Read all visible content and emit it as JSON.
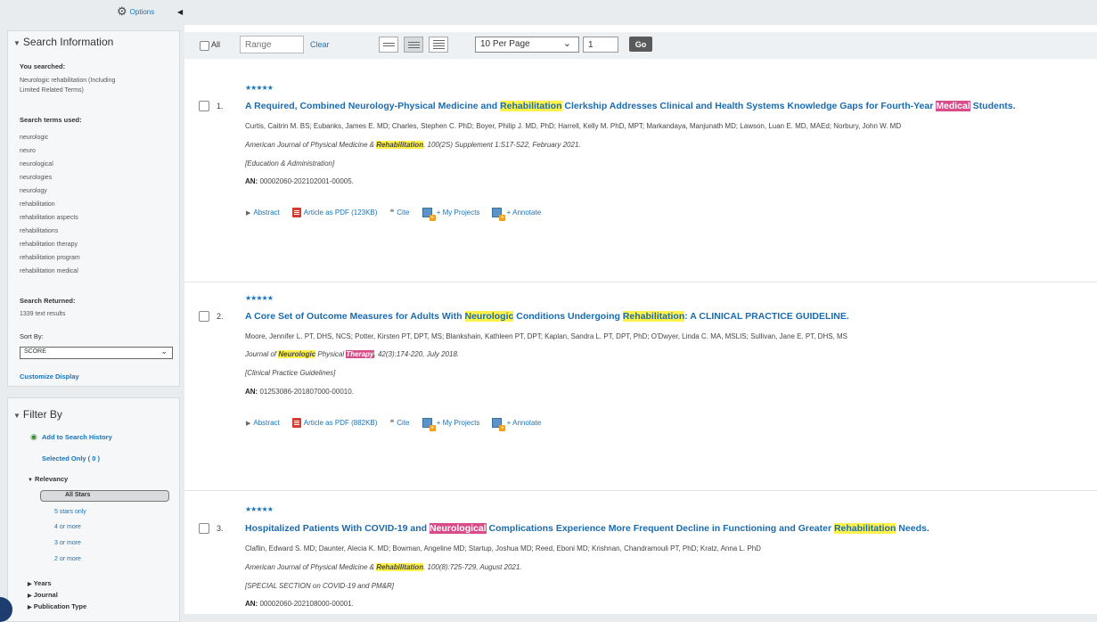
{
  "options": {
    "label": "Options"
  },
  "search_info": {
    "title": "Search Information",
    "you_searched_label": "You searched:",
    "you_searched_lines": [
      "Neurologic rehabilitation (Including",
      "Limited Related Terms)"
    ],
    "terms_label": "Search terms used:",
    "terms": [
      "neurologic",
      "neuro",
      "neurological",
      "neurologies",
      "neurology",
      "rehabilitation",
      "rehabilitation aspects",
      "rehabilitations",
      "rehabilitation therapy",
      "rehabilitation program",
      "rehabilitation medical"
    ],
    "returned_label": "Search Returned:",
    "returned_value": "1339 text results",
    "sort_label": "Sort By:",
    "sort_value": "SCORE",
    "customize_label": "Customize Display"
  },
  "filter": {
    "title": "Filter By",
    "add_history": "Add to Search History",
    "selected_only": "Selected Only ( 0 )",
    "relevancy_label": "Relevancy",
    "all_stars": "All Stars",
    "star_options": [
      "5 stars only",
      "4 or more",
      "3 or more",
      "2 or more"
    ],
    "groups": [
      "Years",
      "Journal",
      "Publication Type"
    ]
  },
  "toolbar": {
    "all_label": "All",
    "range_placeholder": "Range",
    "clear_label": "Clear",
    "per_page": "10 Per Page",
    "page": "1",
    "go_label": "Go"
  },
  "actions": {
    "abstract": "Abstract",
    "cite": "Cite",
    "my_projects": "+ My Projects",
    "annotate": "+ Annotate"
  },
  "results": [
    {
      "num": "1.",
      "stars": "★★★★★",
      "title_parts": [
        "A Required, Combined Neurology-Physical Medicine and ",
        "Rehabilitation",
        " Clerkship Addresses Clinical and Health Systems Knowledge Gaps for Fourth-Year ",
        "Medical",
        " Students."
      ],
      "authors": "Curtis, Caitrin M. BS; Eubanks, James E. MD; Charles, Stephen C. PhD; Boyer, Philip J. MD, PhD; Harrell, Kelly M. PhD, MPT; Markandaya, Manjunath MD; Lawson, Luan E. MD, MAEd; Norbury, John W. MD",
      "journal_parts": [
        "American Journal of Physical Medicine & ",
        "Rehabilitation",
        ". 100(2S) Supplement 1:S17-S22, February 2021."
      ],
      "section": "[Education & Administration]",
      "an_label": "AN:",
      "an_value": "00002060-202102001-00005.",
      "pdf_label": "Article as PDF (123KB)"
    },
    {
      "num": "2.",
      "stars": "★★★★★",
      "title_parts": [
        "A Core Set of Outcome Measures for Adults With ",
        "Neurologic",
        " Conditions Undergoing ",
        "Rehabilitation",
        ": A CLINICAL PRACTICE GUIDELINE."
      ],
      "authors": "Moore, Jennifer L. PT, DHS, NCS; Potter, Kirsten PT, DPT, MS; Blankshain, Kathleen PT, DPT; Kaplan, Sandra L. PT, DPT, PhD; O'Dwyer, Linda C. MA, MSLIS; Sullivan, Jane E. PT, DHS, MS",
      "journal_parts": [
        "Journal of ",
        "Neurologic",
        " Physical ",
        "Therapy",
        ". 42(3):174-220, July 2018."
      ],
      "section": "[Clinical Practice Guidelines]",
      "an_label": "AN:",
      "an_value": "01253086-201807000-00010.",
      "pdf_label": "Article as PDF (882KB)"
    },
    {
      "num": "3.",
      "stars": "★★★★★",
      "title_parts": [
        "Hospitalized Patients With COVID-19 and ",
        "Neurological",
        " Complications Experience More Frequent Decline in Functioning and Greater ",
        "Rehabilitation",
        " Needs."
      ],
      "authors": "Claflin, Edward S. MD; Daunter, Alecia K. MD; Bowman, Angeline MD; Startup, Joshua MD; Reed, Eboni MD; Krishnan, Chandramouli PT, PhD; Kratz, Anna L. PhD",
      "journal_parts": [
        "American Journal of Physical Medicine & ",
        "Rehabilitation",
        ". 100(8):725-729, August 2021."
      ],
      "section": "[SPECIAL SECTION on COVID-19 and PM&R]",
      "an_label": "AN:",
      "an_value": "00002060-202108000-00001."
    }
  ],
  "colors": {
    "link": "#1a73b8",
    "highlight_yellow": "#fff24a",
    "highlight_pink": "#d94c8a"
  }
}
